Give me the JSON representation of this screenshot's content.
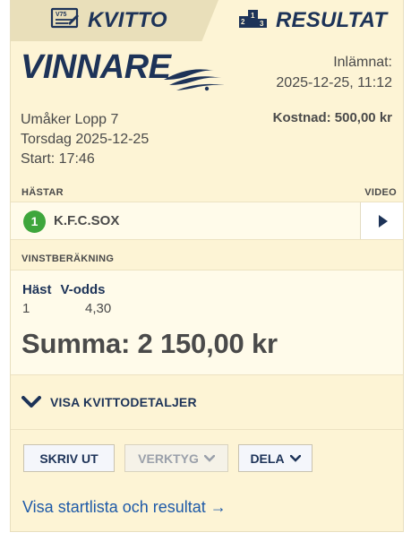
{
  "tabs": {
    "kvitto": {
      "label": "KVITTO",
      "icon": "ticket-icon",
      "icon_text": "V75"
    },
    "resultat": {
      "label": "RESULTAT",
      "icon": "podium-icon"
    }
  },
  "header": {
    "brand": "VINNARE",
    "submitted_label": "Inlämnat:",
    "submitted_time": "2025-12-25, 11:12"
  },
  "race": {
    "name": "Umåker Lopp 7",
    "date": "Torsdag 2025-12-25",
    "start": "Start: 17:46",
    "cost": "Kostnad: 500,00 kr"
  },
  "horses_section": {
    "title": "HÄSTAR",
    "video_label": "VIDEO",
    "horse": {
      "number": "1",
      "name": "K.F.C.SOX",
      "badge_color": "#3ea63c"
    }
  },
  "calculation": {
    "title": "VINSTBERÄKNING",
    "col_horse": "Häst",
    "col_odds": "V-odds",
    "row_horse": "1",
    "row_odds": "4,30",
    "sum": "Summa: 2 150,00 kr"
  },
  "details": {
    "label": "VISA KVITTODETALJER"
  },
  "actions": {
    "print": "SKRIV UT",
    "tools": "VERKTYG",
    "share": "DELA"
  },
  "link": {
    "label": "Visa startlista och resultat →"
  },
  "colors": {
    "background": "#fdf4d5",
    "navy": "#1d3358",
    "link": "#1e5aa8",
    "badge": "#3ea63c"
  }
}
